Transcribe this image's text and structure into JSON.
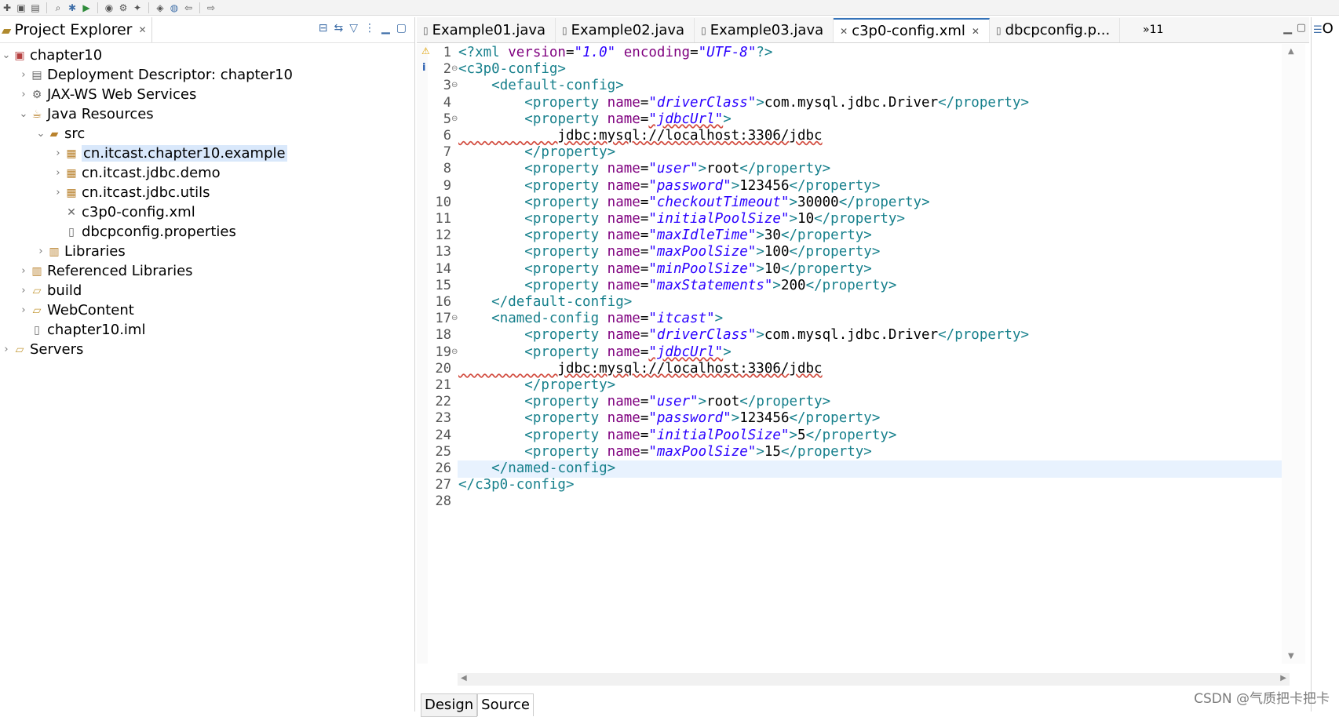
{
  "toolbar": {
    "icons": [
      "new-icon",
      "save-icon",
      "save-all-icon",
      "search-icon",
      "debug-icon",
      "run-icon",
      "coverage-icon",
      "external-tools-icon",
      "new-wizard-icon",
      "open-type-icon",
      "globe-icon",
      "back-icon",
      "forward-icon"
    ]
  },
  "explorer": {
    "title": "Project Explorer",
    "tree": [
      {
        "label": "chapter10",
        "depth": 0,
        "arrow": "⌄",
        "icon": "project-icon"
      },
      {
        "label": "Deployment Descriptor: chapter10",
        "depth": 1,
        "arrow": "›",
        "icon": "descriptor-icon"
      },
      {
        "label": "JAX-WS Web Services",
        "depth": 1,
        "arrow": "›",
        "icon": "webservice-icon"
      },
      {
        "label": "Java Resources",
        "depth": 1,
        "arrow": "⌄",
        "icon": "java-resources-icon"
      },
      {
        "label": "src",
        "depth": 2,
        "arrow": "⌄",
        "icon": "source-folder-icon"
      },
      {
        "label": "cn.itcast.chapter10.example",
        "depth": 3,
        "arrow": "›",
        "icon": "package-icon",
        "selected": true
      },
      {
        "label": "cn.itcast.jdbc.demo",
        "depth": 3,
        "arrow": "›",
        "icon": "package-icon"
      },
      {
        "label": "cn.itcast.jdbc.utils",
        "depth": 3,
        "arrow": "›",
        "icon": "package-icon"
      },
      {
        "label": "c3p0-config.xml",
        "depth": 3,
        "arrow": "",
        "icon": "xml-file-icon"
      },
      {
        "label": "dbcpconfig.properties",
        "depth": 3,
        "arrow": "",
        "icon": "properties-file-icon"
      },
      {
        "label": "Libraries",
        "depth": 2,
        "arrow": "›",
        "icon": "libraries-icon"
      },
      {
        "label": "Referenced Libraries",
        "depth": 1,
        "arrow": "›",
        "icon": "libraries-icon"
      },
      {
        "label": "build",
        "depth": 1,
        "arrow": "›",
        "icon": "folder-icon"
      },
      {
        "label": "WebContent",
        "depth": 1,
        "arrow": "›",
        "icon": "folder-icon"
      },
      {
        "label": "chapter10.iml",
        "depth": 1,
        "arrow": "",
        "icon": "file-icon"
      },
      {
        "label": "Servers",
        "depth": 0,
        "arrow": "›",
        "icon": "folder-icon"
      }
    ]
  },
  "editor": {
    "tabs": [
      {
        "label": "Example01.java",
        "active": false
      },
      {
        "label": "Example02.java",
        "active": false
      },
      {
        "label": "Example03.java",
        "active": false
      },
      {
        "label": "c3p0-config.xml",
        "active": true
      },
      {
        "label": "dbcpconfig.p...",
        "active": false
      }
    ],
    "overflow": "»11",
    "bottom_tabs": {
      "design": "Design",
      "source": "Source"
    },
    "current_line": 26,
    "lines": [
      [
        [
          "tag",
          "<?xml "
        ],
        [
          "attr",
          "version"
        ],
        [
          "txt",
          "="
        ],
        [
          "val",
          "\"1.0\""
        ],
        [
          "txt",
          " "
        ],
        [
          "attr",
          "encoding"
        ],
        [
          "txt",
          "="
        ],
        [
          "val",
          "\"UTF-8\""
        ],
        [
          "tag",
          "?>"
        ]
      ],
      [
        [
          "tag",
          "<c3p0-config>"
        ]
      ],
      [
        [
          "txt",
          "    "
        ],
        [
          "tag",
          "<default-config>"
        ]
      ],
      [
        [
          "txt",
          "        "
        ],
        [
          "tag",
          "<property "
        ],
        [
          "attr",
          "name"
        ],
        [
          "txt",
          "="
        ],
        [
          "val",
          "\"driverClass\""
        ],
        [
          "tag",
          ">"
        ],
        [
          "txt",
          "com.mysql.jdbc.Driver"
        ],
        [
          "tag",
          "</property>"
        ]
      ],
      [
        [
          "txt",
          "        "
        ],
        [
          "tag",
          "<property "
        ],
        [
          "attr",
          "name"
        ],
        [
          "txt",
          "="
        ],
        [
          "val",
          "\"jdbcUrl\""
        ],
        [
          "tag",
          ">"
        ]
      ],
      [
        [
          "txt",
          "            jdbc:mysql://localhost:3306/jdbc"
        ]
      ],
      [
        [
          "txt",
          "        "
        ],
        [
          "tag",
          "</property>"
        ]
      ],
      [
        [
          "txt",
          "        "
        ],
        [
          "tag",
          "<property "
        ],
        [
          "attr",
          "name"
        ],
        [
          "txt",
          "="
        ],
        [
          "val",
          "\"user\""
        ],
        [
          "tag",
          ">"
        ],
        [
          "txt",
          "root"
        ],
        [
          "tag",
          "</property>"
        ]
      ],
      [
        [
          "txt",
          "        "
        ],
        [
          "tag",
          "<property "
        ],
        [
          "attr",
          "name"
        ],
        [
          "txt",
          "="
        ],
        [
          "val",
          "\"password\""
        ],
        [
          "tag",
          ">"
        ],
        [
          "txt",
          "123456"
        ],
        [
          "tag",
          "</property>"
        ]
      ],
      [
        [
          "txt",
          "        "
        ],
        [
          "tag",
          "<property "
        ],
        [
          "attr",
          "name"
        ],
        [
          "txt",
          "="
        ],
        [
          "val",
          "\"checkoutTimeout\""
        ],
        [
          "tag",
          ">"
        ],
        [
          "txt",
          "30000"
        ],
        [
          "tag",
          "</property>"
        ]
      ],
      [
        [
          "txt",
          "        "
        ],
        [
          "tag",
          "<property "
        ],
        [
          "attr",
          "name"
        ],
        [
          "txt",
          "="
        ],
        [
          "val",
          "\"initialPoolSize\""
        ],
        [
          "tag",
          ">"
        ],
        [
          "txt",
          "10"
        ],
        [
          "tag",
          "</property>"
        ]
      ],
      [
        [
          "txt",
          "        "
        ],
        [
          "tag",
          "<property "
        ],
        [
          "attr",
          "name"
        ],
        [
          "txt",
          "="
        ],
        [
          "val",
          "\"maxIdleTime\""
        ],
        [
          "tag",
          ">"
        ],
        [
          "txt",
          "30"
        ],
        [
          "tag",
          "</property>"
        ]
      ],
      [
        [
          "txt",
          "        "
        ],
        [
          "tag",
          "<property "
        ],
        [
          "attr",
          "name"
        ],
        [
          "txt",
          "="
        ],
        [
          "val",
          "\"maxPoolSize\""
        ],
        [
          "tag",
          ">"
        ],
        [
          "txt",
          "100"
        ],
        [
          "tag",
          "</property>"
        ]
      ],
      [
        [
          "txt",
          "        "
        ],
        [
          "tag",
          "<property "
        ],
        [
          "attr",
          "name"
        ],
        [
          "txt",
          "="
        ],
        [
          "val",
          "\"minPoolSize\""
        ],
        [
          "tag",
          ">"
        ],
        [
          "txt",
          "10"
        ],
        [
          "tag",
          "</property>"
        ]
      ],
      [
        [
          "txt",
          "        "
        ],
        [
          "tag",
          "<property "
        ],
        [
          "attr",
          "name"
        ],
        [
          "txt",
          "="
        ],
        [
          "val",
          "\"maxStatements\""
        ],
        [
          "tag",
          ">"
        ],
        [
          "txt",
          "200"
        ],
        [
          "tag",
          "</property>"
        ]
      ],
      [
        [
          "txt",
          "    "
        ],
        [
          "tag",
          "</default-config>"
        ]
      ],
      [
        [
          "txt",
          "    "
        ],
        [
          "tag",
          "<named-config "
        ],
        [
          "attr",
          "name"
        ],
        [
          "txt",
          "="
        ],
        [
          "val",
          "\"itcast\""
        ],
        [
          "tag",
          ">"
        ]
      ],
      [
        [
          "txt",
          "        "
        ],
        [
          "tag",
          "<property "
        ],
        [
          "attr",
          "name"
        ],
        [
          "txt",
          "="
        ],
        [
          "val",
          "\"driverClass\""
        ],
        [
          "tag",
          ">"
        ],
        [
          "txt",
          "com.mysql.jdbc.Driver"
        ],
        [
          "tag",
          "</property>"
        ]
      ],
      [
        [
          "txt",
          "        "
        ],
        [
          "tag",
          "<property "
        ],
        [
          "attr",
          "name"
        ],
        [
          "txt",
          "="
        ],
        [
          "val",
          "\"jdbcUrl\""
        ],
        [
          "tag",
          ">"
        ]
      ],
      [
        [
          "txt",
          "            jdbc:mysql://localhost:3306/jdbc"
        ]
      ],
      [
        [
          "txt",
          "        "
        ],
        [
          "tag",
          "</property>"
        ]
      ],
      [
        [
          "txt",
          "        "
        ],
        [
          "tag",
          "<property "
        ],
        [
          "attr",
          "name"
        ],
        [
          "txt",
          "="
        ],
        [
          "val",
          "\"user\""
        ],
        [
          "tag",
          ">"
        ],
        [
          "txt",
          "root"
        ],
        [
          "tag",
          "</property>"
        ]
      ],
      [
        [
          "txt",
          "        "
        ],
        [
          "tag",
          "<property "
        ],
        [
          "attr",
          "name"
        ],
        [
          "txt",
          "="
        ],
        [
          "val",
          "\"password\""
        ],
        [
          "tag",
          ">"
        ],
        [
          "txt",
          "123456"
        ],
        [
          "tag",
          "</property>"
        ]
      ],
      [
        [
          "txt",
          "        "
        ],
        [
          "tag",
          "<property "
        ],
        [
          "attr",
          "name"
        ],
        [
          "txt",
          "="
        ],
        [
          "val",
          "\"initialPoolSize\""
        ],
        [
          "tag",
          ">"
        ],
        [
          "txt",
          "5"
        ],
        [
          "tag",
          "</property>"
        ]
      ],
      [
        [
          "txt",
          "        "
        ],
        [
          "tag",
          "<property "
        ],
        [
          "attr",
          "name"
        ],
        [
          "txt",
          "="
        ],
        [
          "val",
          "\"maxPoolSize\""
        ],
        [
          "tag",
          ">"
        ],
        [
          "txt",
          "15"
        ],
        [
          "tag",
          "</property>"
        ]
      ],
      [
        [
          "txt",
          "    "
        ],
        [
          "tag",
          "</named-config>"
        ]
      ],
      [
        [
          "tag",
          "</c3p0-config>"
        ]
      ],
      []
    ],
    "folds": [
      2,
      3,
      5,
      17,
      19
    ]
  },
  "outline": {
    "title": "O"
  },
  "watermark": "CSDN @气质把卡把卡"
}
